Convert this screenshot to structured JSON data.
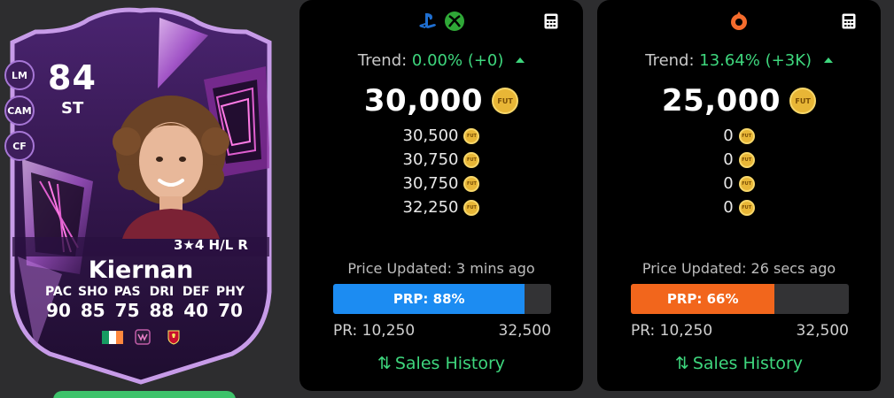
{
  "card": {
    "rating": "84",
    "position": "ST",
    "alt_positions": [
      "LM",
      "CAM",
      "CF"
    ],
    "skill_line": "3★4 H/L R",
    "name": "Kiernan",
    "stat_labels": [
      "PAC",
      "SHO",
      "PAS",
      "DRI",
      "DEF",
      "PHY"
    ],
    "stat_values": [
      "90",
      "85",
      "75",
      "88",
      "40",
      "70"
    ],
    "nation_icon": "ireland-flag-icon",
    "league_icon": "wsl-league-icon",
    "club_icon": "liverpool-crest-icon",
    "colors": {
      "frame": "#c79be8",
      "fill": "#3b1b57",
      "accent": "#e05fd0"
    }
  },
  "panels": [
    {
      "platform_icons": [
        "playstation-icon",
        "xbox-icon"
      ],
      "calculator_icon": "calculator-icon",
      "trend_label": "Trend:",
      "trend_value": "0.00% (+0)",
      "price": "30,000",
      "coin_label": "FUT",
      "prices": [
        "30,500",
        "30,750",
        "30,750",
        "32,250"
      ],
      "updated": "Price Updated: 3 mins ago",
      "prp_label": "PRP: 88%",
      "prp_fraction": 0.88,
      "prp_color": "#1c8cf2",
      "pr_min": "PR: 10,250",
      "pr_max": "32,500",
      "sales_label": "Sales History"
    },
    {
      "platform_icons": [
        "origin-icon"
      ],
      "calculator_icon": "calculator-icon",
      "trend_label": "Trend:",
      "trend_value": "13.64% (+3K)",
      "price": "25,000",
      "coin_label": "FUT",
      "prices": [
        "0",
        "0",
        "0",
        "0"
      ],
      "updated": "Price Updated: 26 secs ago",
      "prp_label": "PRP: 66%",
      "prp_fraction": 0.66,
      "prp_color": "#f2661c",
      "pr_min": "PR: 10,250",
      "pr_max": "32,500",
      "sales_label": "Sales History"
    }
  ],
  "colors": {
    "trend_green": "#3ed67d",
    "background": "#2d2d2f",
    "panel": "#000000"
  }
}
